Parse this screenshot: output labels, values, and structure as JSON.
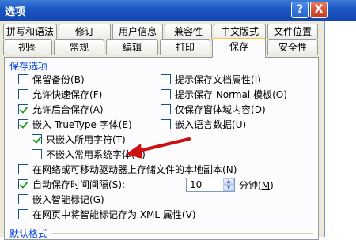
{
  "window": {
    "title": "选项",
    "help_glyph": "?",
    "close_glyph": "X"
  },
  "tabs": {
    "row1": [
      "拼写和语法",
      "修订",
      "用户信息",
      "兼容性",
      "中文版式",
      "文件位置"
    ],
    "row2": [
      "视图",
      "常规",
      "编辑",
      "打印",
      "保存",
      "安全性"
    ],
    "active": "保存"
  },
  "save_options": {
    "group_title": "保存选项",
    "left": [
      {
        "label": "保留备份",
        "key": "B",
        "checked": false
      },
      {
        "label": "允许快速保存",
        "key": "F",
        "checked": false
      },
      {
        "label": "允许后台保存",
        "key": "A",
        "checked": true
      },
      {
        "label": "嵌入 TrueType 字体",
        "key": "E",
        "checked": true
      }
    ],
    "right": [
      {
        "label": "提示保存文档属性",
        "key": "I",
        "checked": false
      },
      {
        "label": "提示保存 Normal 模板",
        "key": "O",
        "checked": false
      },
      {
        "label": "仅保存窗体域内容",
        "key": "D",
        "checked": false
      },
      {
        "label": "嵌入语言数据",
        "key": "U",
        "checked": false
      }
    ],
    "font_sub": [
      {
        "label": "只嵌入所用字符",
        "key": "T",
        "checked": true
      },
      {
        "label": "不嵌入常用系统字体",
        "key": "C",
        "checked": false
      }
    ],
    "network_copy": {
      "label": "在网络或可移动驱动器上存储文件的本地副本",
      "key": "N",
      "checked": false
    },
    "autosave": {
      "label": "自动保存时间间隔",
      "key": "S",
      "checked": true,
      "value": "10",
      "unit": "分钟",
      "unit_key": "M"
    },
    "smart_tags": {
      "label": "嵌入智能标记",
      "key": "G",
      "checked": false
    },
    "xml_smart_tags": {
      "label": "在网页中将智能标记存为 XML 属性",
      "key": "V",
      "checked": false
    }
  },
  "default_format": {
    "group_title": "默认格式"
  },
  "colors": {
    "title_bar": "#1a56c4",
    "group_title": "#0046d5",
    "arrow": "#cc1010",
    "active_tab_accent": "#ffc83c"
  }
}
